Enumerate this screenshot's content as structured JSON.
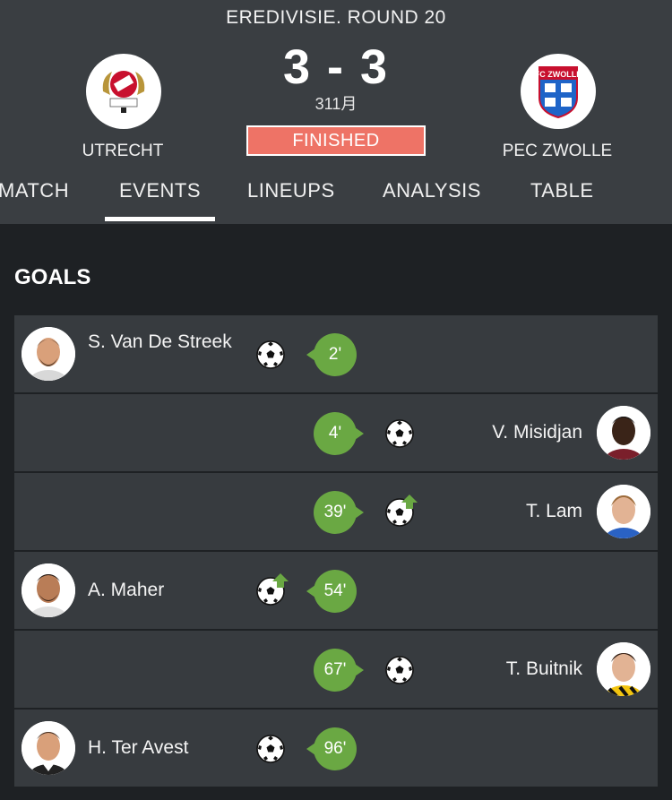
{
  "match": {
    "round": "EREDIVISIE. ROUND 20",
    "score": "3 - 3",
    "date": "311月",
    "status": "FINISHED",
    "home_team": "UTRECHT",
    "away_team": "PEC ZWOLLE",
    "home_logo_icon": "fc-utrecht-crest-icon",
    "away_logo_icon": "pec-zwolle-crest-icon"
  },
  "tabs": [
    {
      "label": "MATCH",
      "active": false
    },
    {
      "label": "EVENTS",
      "active": true
    },
    {
      "label": "LINEUPS",
      "active": false
    },
    {
      "label": "ANALYSIS",
      "active": false
    },
    {
      "label": "TABLE",
      "active": false
    }
  ],
  "goals_section": {
    "title": "GOALS",
    "goals": [
      {
        "side": "home",
        "player": "S. Van De Streek",
        "minute": "2'",
        "type": "goal"
      },
      {
        "side": "away",
        "player": "V. Misidjan",
        "minute": "4'",
        "type": "goal"
      },
      {
        "side": "away",
        "player": "T. Lam",
        "minute": "39'",
        "type": "goal-assist"
      },
      {
        "side": "home",
        "player": "A. Maher",
        "minute": "54'",
        "type": "goal-assist"
      },
      {
        "side": "away",
        "player": "T. Buitnik",
        "minute": "67'",
        "type": "goal"
      },
      {
        "side": "home",
        "player": "H. Ter Avest",
        "minute": "96'",
        "type": "goal"
      }
    ]
  },
  "colors": {
    "header_bg": "#3a3e42",
    "page_bg": "#1e2124",
    "row_bg": "#373b3f",
    "status_bg": "#ee7366",
    "minute_bg": "#6aa843"
  }
}
